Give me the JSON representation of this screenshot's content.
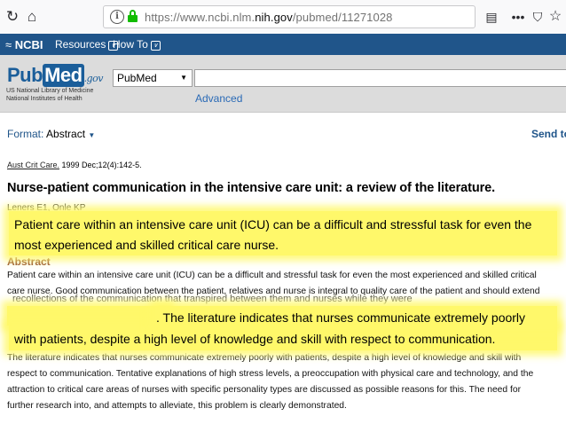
{
  "browser": {
    "url_prefix": "https://www.ncbi.nlm.",
    "url_domain": "nih.gov",
    "url_path": "/pubmed/11271028"
  },
  "ncbi_bar": {
    "logo": "NCBI",
    "resources": "Resources",
    "how_to": "How To"
  },
  "header": {
    "logo_pub": "Pub",
    "logo_med": "Med",
    "logo_gov": ".gov",
    "logo_sub_1": "US National Library of Medicine",
    "logo_sub_2": "National Institutes of Health",
    "database_select": "PubMed",
    "search_value": "",
    "advanced_link": "Advanced"
  },
  "toolbar": {
    "format_label": "Format:",
    "format_value": "Abstract",
    "send_to": "Send to"
  },
  "article": {
    "citation_journal": "Aust Crit Care.",
    "citation_rest": "1999 Dec;12(4):142-5.",
    "title": "Nurse-patient communication in the intensive care unit: a review of the literature.",
    "authors": "Leners E1, Onle KP",
    "abstract_label": "Abstract",
    "abstract_lines": [
      "Patient care within an intensive care unit (ICU) can be a difficult and stressful task for even the most experienced and skilled critical",
      "care nurse. Good communication between the patient, relatives and nurse is integral to quality care of the patient and should extend",
      "The literature indicates that nurses communicate extremely poorly with patients, despite a high level of knowledge and skill with",
      "respect to communication. Tentative explanations of high stress levels, a preoccupation with physical care and technology, and the",
      "attraction to critical care areas of nurses with specific personality types are discussed as possible reasons for this. The need for",
      "further research into, and attempts to alleviate, this problem is clearly demonstrated."
    ],
    "obscured_line": "recollections of the communication that transpired between them and nurses while they were"
  },
  "callouts": {
    "top_line_1": "Patient care within an intensive care unit (ICU) can be a difficult and stressful task for even the",
    "top_line_2": "most experienced and skilled critical care nurse.",
    "bottom_line_1": ". The literature indicates that nurses communicate extremely poorly",
    "bottom_line_2": "with patients, despite a high level of knowledge and skill with respect to communication.",
    "color": "#fff86a"
  }
}
